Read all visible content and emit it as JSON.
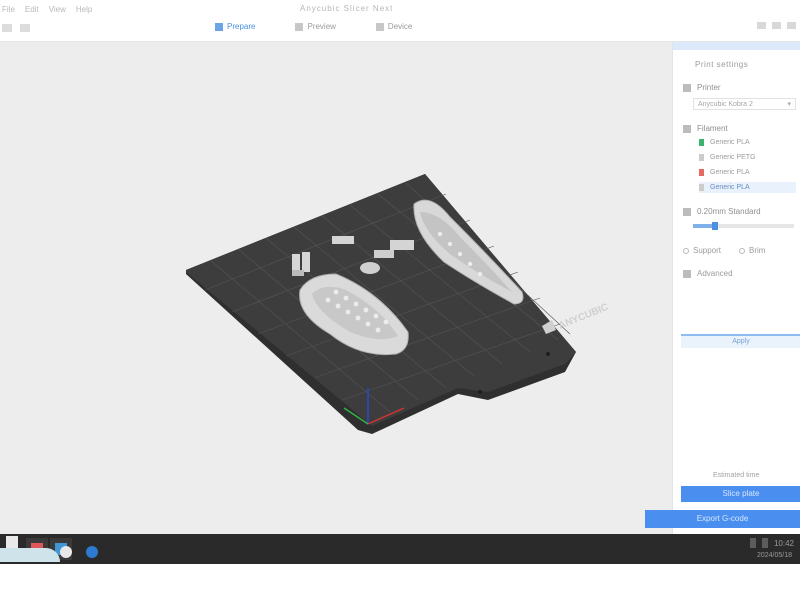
{
  "menu": {
    "items": [
      "File",
      "Edit",
      "View",
      "Help"
    ],
    "title": "Anycubic Slicer Next"
  },
  "tabs": [
    {
      "label": "Prepare",
      "active": true
    },
    {
      "label": "Preview",
      "active": false
    },
    {
      "label": "Device",
      "active": false
    }
  ],
  "bed": {
    "brand": "ANYCUBIC",
    "accent": "#d8d8d8",
    "plate_color": "#3a3a3a"
  },
  "panel": {
    "title": "Print settings",
    "printer": {
      "label": "Printer",
      "value": "Anycubic Kobra 2"
    },
    "filament": {
      "label": "Filament",
      "items": [
        {
          "label": "Generic PLA",
          "color": "#3cb371",
          "selected": false
        },
        {
          "label": "Generic PETG",
          "color": "#9c9c9c",
          "selected": false
        },
        {
          "label": "Generic PLA",
          "color": "#e36a5f",
          "selected": false
        },
        {
          "label": "Generic PLA",
          "color": "#9c9c9c",
          "selected": true
        }
      ]
    },
    "process": {
      "label": "Process",
      "value": "0.20mm Standard"
    },
    "slider_value": 0.22,
    "supports": {
      "option_a": "Support",
      "option_b": "Brim"
    },
    "advanced_label": "Advanced",
    "apply_label": "Apply",
    "estimate": "Estimated time",
    "slice_label": "Slice plate",
    "export_label": "Export G-code"
  },
  "taskbar": {
    "time": "10:42",
    "date": "2024/05/18"
  }
}
